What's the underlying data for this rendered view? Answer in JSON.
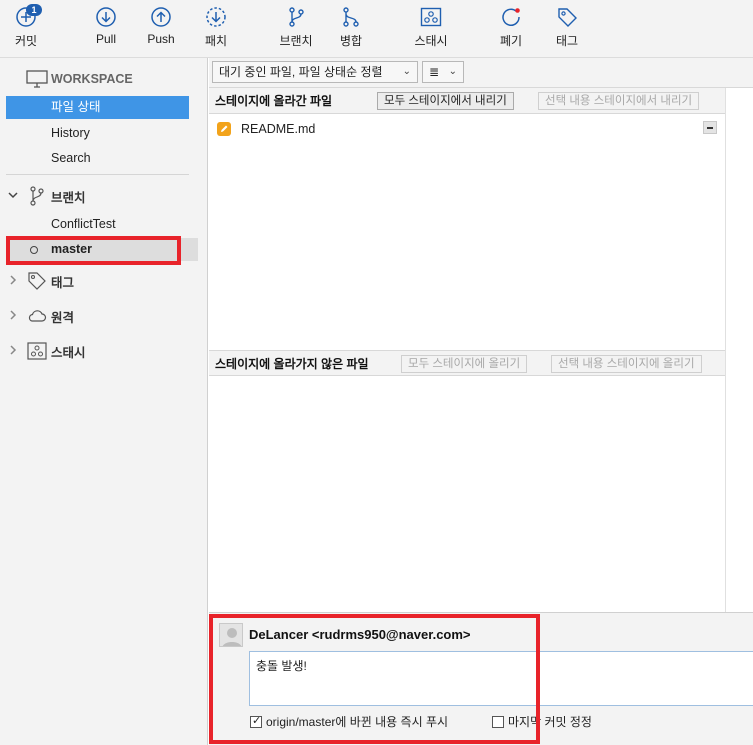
{
  "toolbar": {
    "commit": {
      "label": "커밋",
      "badge": "1"
    },
    "pull": {
      "label": "Pull"
    },
    "push": {
      "label": "Push"
    },
    "fetch": {
      "label": "패치"
    },
    "branch": {
      "label": "브랜치"
    },
    "merge": {
      "label": "병합"
    },
    "stash": {
      "label": "스태시"
    },
    "discard": {
      "label": "폐기"
    },
    "tag": {
      "label": "태그"
    }
  },
  "sidebar": {
    "workspace": {
      "title": "WORKSPACE",
      "items": [
        "파일 상태",
        "History",
        "Search"
      ]
    },
    "branches": {
      "title": "브랜치",
      "items": [
        "ConflictTest",
        "master"
      ]
    },
    "tags": {
      "title": "태그"
    },
    "remotes": {
      "title": "원격"
    },
    "stashes": {
      "title": "스태시"
    }
  },
  "filter": {
    "sort_label": "대기 중인 파일, 파일 상태순 정렬",
    "view_label": "≣"
  },
  "staged": {
    "title": "스테이지에 올라간 파일",
    "unstage_all": "모두 스테이지에서 내리기",
    "unstage_selected": "선택 내용 스테이지에서 내리기",
    "files": [
      {
        "name": "README.md",
        "status": "modified"
      }
    ]
  },
  "unstaged": {
    "title": "스테이지에 올라가지 않은 파일",
    "stage_all": "모두 스테이지에 올리기",
    "stage_selected": "선택 내용 스테이지에 올리기"
  },
  "commit": {
    "author": "DeLancer <rudrms950@naver.com>",
    "message": "충돌 발생!",
    "push_option": "origin/master에 바뀐 내용 즉시 푸시",
    "push_checked": true,
    "amend_option": "마지막 커밋 정정",
    "amend_checked": false
  },
  "colors": {
    "accent": "#3f95e6",
    "highlight": "#e8232a",
    "icon_blue": "#1f5fb0",
    "modified_badge": "#f2a31b"
  }
}
